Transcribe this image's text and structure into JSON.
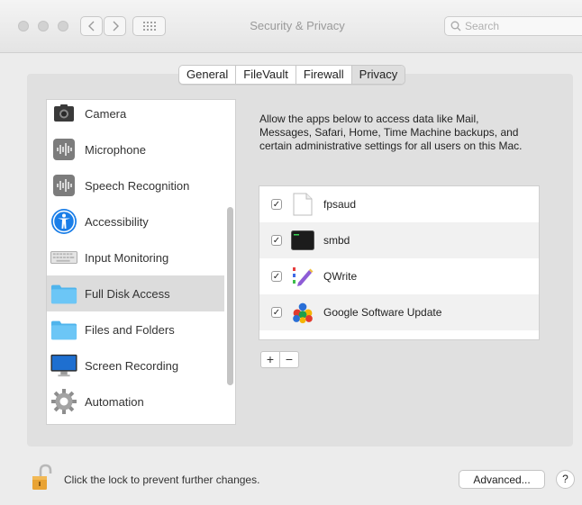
{
  "window": {
    "title": "Security & Privacy"
  },
  "toolbar": {
    "back_icon": "chevron-left-icon",
    "forward_icon": "chevron-right-icon",
    "grid_icon": "grid-icon",
    "search_placeholder": "Search"
  },
  "tabs": [
    {
      "label": "General"
    },
    {
      "label": "FileVault"
    },
    {
      "label": "Firewall"
    },
    {
      "label": "Privacy",
      "active": true
    }
  ],
  "sidebar": {
    "items": [
      {
        "label": "Camera",
        "icon": "camera-icon"
      },
      {
        "label": "Microphone",
        "icon": "microphone-icon"
      },
      {
        "label": "Speech Recognition",
        "icon": "speech-recognition-icon"
      },
      {
        "label": "Accessibility",
        "icon": "accessibility-icon"
      },
      {
        "label": "Input Monitoring",
        "icon": "keyboard-icon"
      },
      {
        "label": "Full Disk Access",
        "icon": "folder-icon",
        "selected": true
      },
      {
        "label": "Files and Folders",
        "icon": "folder-icon"
      },
      {
        "label": "Screen Recording",
        "icon": "display-icon"
      },
      {
        "label": "Automation",
        "icon": "gear-icon"
      }
    ]
  },
  "main": {
    "description": "Allow the apps below to access data like Mail, Messages, Safari, Home, Time Machine backups, and certain administrative settings for all users on this Mac.",
    "apps": [
      {
        "label": "fpsaud",
        "checked": true,
        "icon": "document-icon"
      },
      {
        "label": "smbd",
        "checked": true,
        "icon": "terminal-icon"
      },
      {
        "label": "QWrite",
        "checked": true,
        "icon": "qwrite-icon"
      },
      {
        "label": "Google Software Update",
        "checked": true,
        "icon": "google-software-update-icon"
      }
    ],
    "add_label": "+",
    "remove_label": "−"
  },
  "footer": {
    "lock_text": "Click the lock to prevent further changes.",
    "advanced_label": "Advanced...",
    "help_label": "?"
  },
  "colors": {
    "selected_row": "#dcdcdc",
    "panel": "#e0e0e0",
    "window": "#ececec"
  }
}
